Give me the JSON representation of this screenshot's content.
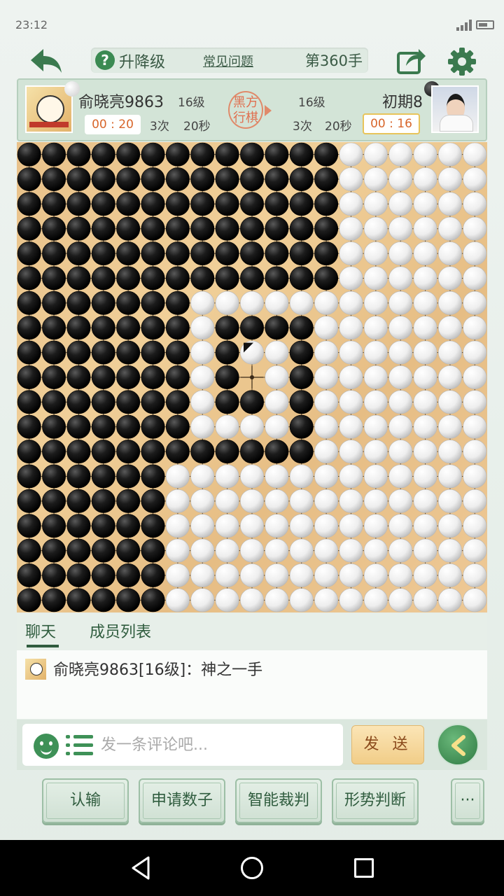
{
  "status_bar": {
    "time": "23:12",
    "icons": [
      "signal-icon",
      "battery-icon"
    ]
  },
  "header": {
    "level_label": "升降级",
    "faq_label": "常见问题",
    "move_count": "第360手",
    "icons": [
      "back-arrow-icon",
      "question-icon",
      "share-icon",
      "gear-icon"
    ]
  },
  "players": {
    "left": {
      "name": "俞晓亮9863",
      "rank": "16级",
      "timer": "00 : 20",
      "tries": "3次",
      "seconds": "20秒",
      "stone": "white"
    },
    "right": {
      "name": "初期8",
      "rank": "16级",
      "timer": "00 : 16",
      "tries": "3次",
      "seconds": "20秒",
      "stone": "black"
    },
    "turn_seal": "黑方行棋"
  },
  "board": {
    "size": 19,
    "rows": [
      "BBBBBBBBBBBBBWWWWWW",
      "BBBBBBBBBBBBBWWWWWW",
      "BBBBBBBBBBBBBWWWWWW",
      "BBBBBBBBBBBBBWWWWWW",
      "BBBBBBBBBBBBBWWWWWW",
      "BBBBBBBBBBBBBWWWWWW",
      "BBBBBBBWWWWWWWWWWWW",
      "BBBBBBBWBBBBWWWWWWW",
      "BBBBBBBWBWWBWWWWWWW",
      "BBBBBBBWB.WBWWWWWWW",
      "BBBBBBBWBBWBWWWWWWW",
      "BBBBBBBWWWWBWWWWWWW",
      "BBBBBBBBBBBBWWWWWWW",
      "BBBBBBWWWWWWWWWWWWW",
      "BBBBBBWWWWWWWWWWWWW",
      "BBBBBBWWWWWWWWWWWWW",
      "BBBBBBWWWWWWWWWWWWW",
      "BBBBBBWWWWWWWWWWWWW",
      "BBBBBBWWWWWWWWWWWWW"
    ],
    "last_move": {
      "row": 8,
      "col": 9
    },
    "colors": {
      "wood": "#eec996",
      "black_stone": "#111111",
      "white_stone": "#f4f4f4"
    }
  },
  "chat": {
    "tabs": [
      "聊天",
      "成员列表"
    ],
    "messages": [
      {
        "author": "俞晓亮9863[16级]",
        "separator": "：",
        "text": "神之一手"
      }
    ]
  },
  "input": {
    "placeholder": "发一条评论吧...",
    "send_label": "发 送",
    "icons": [
      "smile-icon",
      "list-icon",
      "chevron-left-icon"
    ]
  },
  "actions": [
    "认输",
    "申请数子",
    "智能裁判",
    "形势判断",
    "···"
  ],
  "nav": {
    "icons": [
      "nav-back-icon",
      "nav-home-icon",
      "nav-recent-icon"
    ]
  },
  "colors": {
    "accent": "#3b8a52",
    "panel": "#d3e4d7",
    "timer_text": "#d8662b",
    "send_bg": "#f1cd88"
  }
}
